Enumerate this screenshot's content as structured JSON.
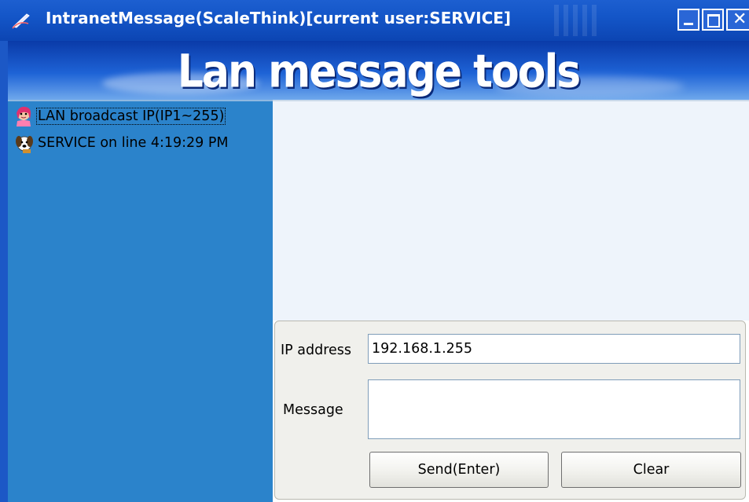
{
  "window": {
    "title": "IntranetMessage(ScaleThink)[current user:SERVICE]",
    "controls": [
      "minimize",
      "maximize",
      "close"
    ]
  },
  "banner": {
    "title": "Lan message tools"
  },
  "user_list": {
    "items": [
      {
        "label": "LAN broadcast IP(IP1~255)",
        "icon": "girl-avatar-icon",
        "selected": true
      },
      {
        "label": "SERVICE on line 4:19:29 PM",
        "icon": "dog-avatar-icon",
        "selected": false
      }
    ]
  },
  "form": {
    "ip_label": "IP address",
    "ip_value": "192.168.1.255",
    "message_label": "Message",
    "message_value": "",
    "send_label": "Send(Enter)",
    "clear_label": "Clear"
  },
  "colors": {
    "titlebar": "#1456c8",
    "user_list_bg": "#2b83cb",
    "message_area_bg": "#eef4fb",
    "panel_bg": "#f0f0ec"
  }
}
